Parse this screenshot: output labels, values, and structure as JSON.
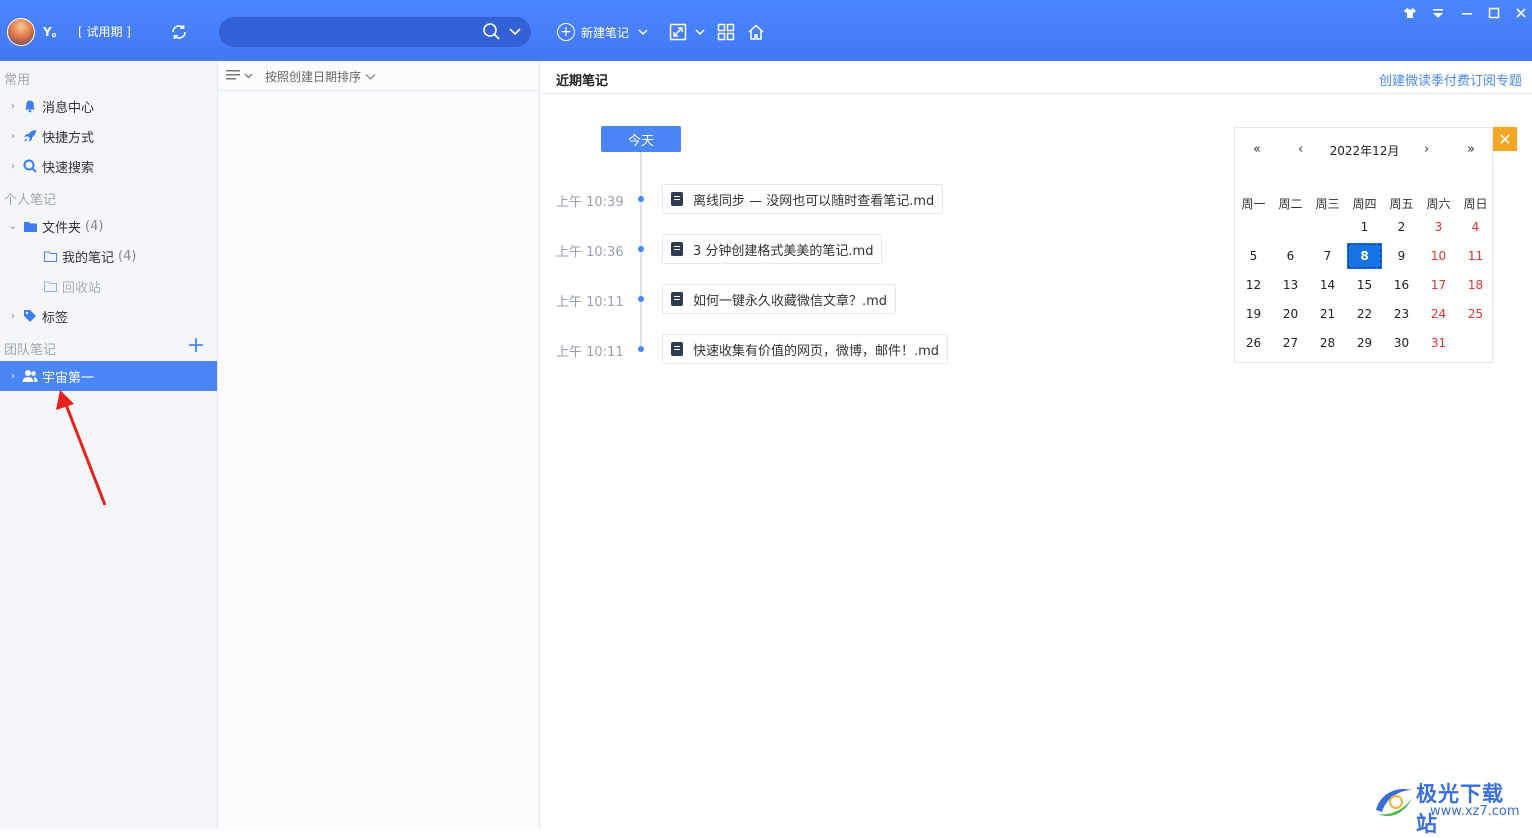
{
  "header": {
    "username": "Y。",
    "trial_label": "[ 试用期 ]",
    "search_placeholder": "",
    "new_note_label": "新建笔记"
  },
  "sidebar": {
    "sections": {
      "common": "常用",
      "personal": "个人笔记",
      "team": "团队笔记"
    },
    "items": [
      {
        "label": "消息中心"
      },
      {
        "label": "快捷方式"
      },
      {
        "label": "快速搜索"
      },
      {
        "label": "文件夹",
        "count": "(4)"
      },
      {
        "label": "我的笔记",
        "count": "(4)"
      },
      {
        "label": "回收站"
      },
      {
        "label": "标签"
      },
      {
        "label": "宇宙第一"
      }
    ]
  },
  "list": {
    "sort_label": "按照创建日期排序"
  },
  "main": {
    "title": "近期笔记",
    "link": "创建微读季付费订阅专题",
    "today_button": "今天",
    "notes": [
      {
        "time": "上午 10:39",
        "title": "离线同步 — 没网也可以随时查看笔记.md"
      },
      {
        "time": "上午 10:36",
        "title": "3 分钟创建格式美美的笔记.md"
      },
      {
        "time": "上午 10:11",
        "title": "如何一键永久收藏微信文章？.md"
      },
      {
        "time": "上午 10:11",
        "title": "快速收集有价值的网页，微博，邮件！.md"
      }
    ]
  },
  "calendar": {
    "prev_year": "«",
    "prev_month": "‹",
    "title": "2022年12月",
    "next_month": "›",
    "next_year": "»",
    "weekdays": [
      "周一",
      "周二",
      "周三",
      "周四",
      "周五",
      "周六",
      "周日"
    ],
    "selected_day": "8",
    "close": "✕",
    "days": [
      "1",
      "2",
      "3",
      "4",
      "5",
      "6",
      "7",
      "8",
      "9",
      "10",
      "11",
      "12",
      "13",
      "14",
      "15",
      "16",
      "17",
      "18",
      "19",
      "20",
      "21",
      "22",
      "23",
      "24",
      "25",
      "26",
      "27",
      "28",
      "29",
      "30",
      "31"
    ]
  },
  "watermark": {
    "brand": "极光下载站",
    "url": "www.xz7.com"
  },
  "colors": {
    "accent": "#4a86f7",
    "topbar": "#4478f5",
    "weekend": "#dd3333",
    "close": "#f5a623"
  }
}
